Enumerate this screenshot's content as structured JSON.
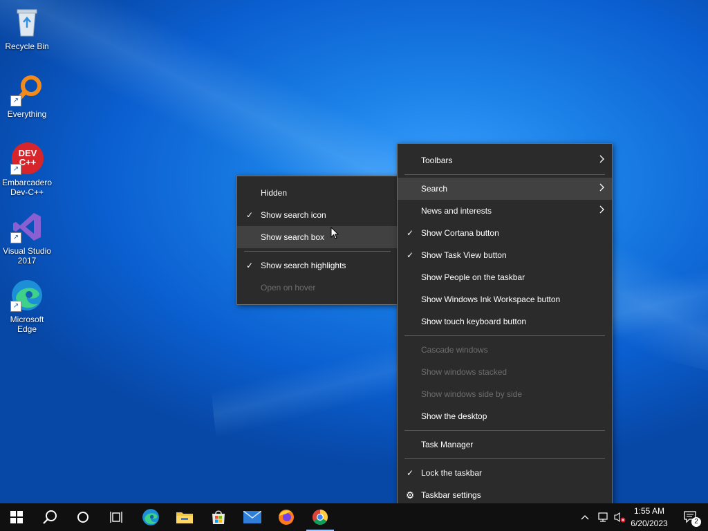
{
  "desktop": {
    "icons": [
      {
        "label": "Recycle Bin",
        "icon": "recycle-bin-icon"
      },
      {
        "label": "Everything",
        "icon": "everything-search-icon"
      },
      {
        "label": "Embarcadero Dev-C++",
        "badge": "DEV C++",
        "icon": "devcpp-icon"
      },
      {
        "label": "Visual Studio 2017",
        "icon": "visual-studio-icon"
      },
      {
        "label": "Microsoft Edge",
        "icon": "edge-icon"
      }
    ]
  },
  "search_submenu": {
    "items": [
      {
        "label": "Hidden",
        "checked": false,
        "enabled": true
      },
      {
        "label": "Show search icon",
        "checked": true,
        "enabled": true
      },
      {
        "label": "Show search box",
        "checked": false,
        "enabled": true,
        "highlighted": true
      },
      {
        "label": "Show search highlights",
        "checked": true,
        "enabled": true
      },
      {
        "label": "Open on hover",
        "checked": false,
        "enabled": false
      }
    ]
  },
  "taskbar_menu": {
    "toolbars": "Toolbars",
    "search": "Search",
    "news": "News and interests",
    "cortana": "Show Cortana button",
    "task_view": "Show Task View button",
    "people": "Show People on the taskbar",
    "ink": "Show Windows Ink Workspace button",
    "touch_keyboard": "Show touch keyboard button",
    "cascade": "Cascade windows",
    "stacked": "Show windows stacked",
    "side_by_side": "Show windows side by side",
    "show_desktop": "Show the desktop",
    "task_manager": "Task Manager",
    "lock": "Lock the taskbar",
    "settings": "Taskbar settings",
    "check_glyph": "✓",
    "arrow_glyph": "›",
    "gear_glyph": "⚙"
  },
  "taskbar": {
    "apps": [
      "start-icon",
      "search-icon",
      "cortana-icon",
      "task-view-icon",
      "edge-icon",
      "file-explorer-icon",
      "store-icon",
      "mail-icon",
      "firefox-icon",
      "chrome-icon"
    ],
    "clock_time": "1:55 AM",
    "clock_date": "6/20/2023",
    "notification_count": "2"
  },
  "colors": {
    "menu_bg": "#2b2b2b",
    "menu_highlight": "#414141",
    "taskbar_bg": "#101010",
    "accent": "#0b5fd0"
  }
}
